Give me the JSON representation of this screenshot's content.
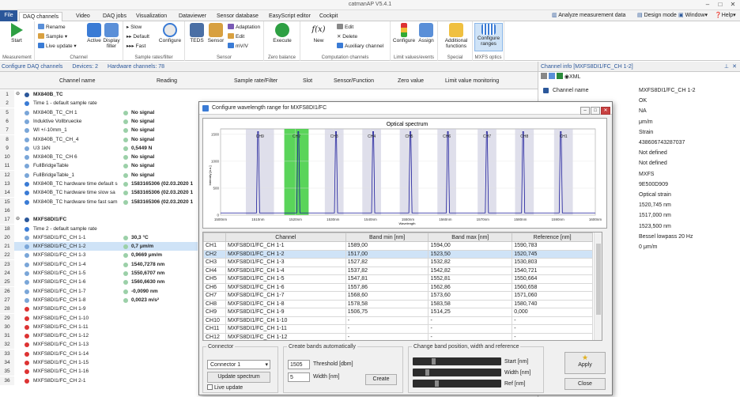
{
  "window": {
    "title": "catmanAP V5.4.1"
  },
  "tabs": [
    {
      "label": "File"
    },
    {
      "label": "DAQ channels"
    },
    {
      "label": "Video"
    },
    {
      "label": "DAQ jobs"
    },
    {
      "label": "Visualization"
    },
    {
      "label": "Dataviewer"
    },
    {
      "label": "Sensor database"
    },
    {
      "label": "EasyScript editor"
    },
    {
      "label": "Cockpit"
    }
  ],
  "right_menu": {
    "analyze": "Analyze measurement data",
    "design": "Design mode",
    "window": "Window",
    "help": "Help"
  },
  "ribbon": {
    "start": "Start",
    "measurement": "Measurement",
    "rename": "Rename",
    "sample": "Sample",
    "live_update": "Live update",
    "channel_group": "Channel",
    "active": "Active",
    "display_filter": "Display filter",
    "slow": "Slow",
    "default": "Default",
    "fast": "Fast",
    "configure": "Configure",
    "sample_group": "Sample rates/filter",
    "teds": "TEDS",
    "sensor": "Sensor",
    "adaptation": "Adaptation",
    "edit": "Edit",
    "mvv": "mV/V",
    "sensor_group": "Sensor",
    "execute": "Execute",
    "zero_group": "Zero balance",
    "new": "New",
    "edit2": "Edit",
    "delete": "Delete",
    "aux": "Auxiliary channel",
    "comp_group": "Computation channels",
    "configure2": "Configure",
    "assign": "Assign",
    "limit_group": "Limit values/events",
    "additional": "Additional functions",
    "special_group": "Special",
    "configure_ranges": "Configure ranges",
    "mxfs_group": "MXFS optics"
  },
  "status": {
    "label": "Configure DAQ channels",
    "devices": "Devices: 2",
    "hardware": "Hardware channels: 78"
  },
  "grid_headers": [
    "Channel name",
    "Reading",
    "Sample rate/Filter",
    "Slot",
    "Sensor/Function",
    "Zero value",
    "Limit value monitoring"
  ],
  "rows": [
    {
      "n": "1",
      "name": "MX840B_TC",
      "reading": "",
      "group": true
    },
    {
      "n": "2",
      "name": "Time  1 - default sample rate",
      "reading": ""
    },
    {
      "n": "5",
      "name": "MX840B_TC_CH 1",
      "reading": "No signal"
    },
    {
      "n": "6",
      "name": "Induktive Vollbruecke",
      "reading": "No signal"
    },
    {
      "n": "7",
      "name": "WI +/-10mm_1",
      "reading": "No signal"
    },
    {
      "n": "8",
      "name": "MX840B_TC_CH_4",
      "reading": "No signal"
    },
    {
      "n": "9",
      "name": "U3 1kN",
      "reading": "0,5449 N"
    },
    {
      "n": "10",
      "name": "MX840B_TC_CH 6",
      "reading": "No signal"
    },
    {
      "n": "11",
      "name": "FullBridgeTable",
      "reading": "No signal"
    },
    {
      "n": "12",
      "name": "FullBridgeTable_1",
      "reading": "No signal"
    },
    {
      "n": "13",
      "name": "MX840B_TC hardware time default s",
      "reading": "1583165306 (02.03.2020 1"
    },
    {
      "n": "14",
      "name": "MX840B_TC hardware time slow sa",
      "reading": "1583165306 (02.03.2020 1"
    },
    {
      "n": "15",
      "name": "MX840B_TC hardware time fast sam",
      "reading": "1583165306 (02.03.2020 1"
    },
    {
      "n": "16",
      "name": "",
      "reading": ""
    },
    {
      "n": "17",
      "name": "MXFS8DI1/FC",
      "reading": "",
      "group": true
    },
    {
      "n": "18",
      "name": "Time  2 - default sample rate",
      "reading": ""
    },
    {
      "n": "20",
      "name": "MXFS8DI1/FC_CH 1-1",
      "reading": "30,3 °C"
    },
    {
      "n": "21",
      "name": "MXFS8DI1/FC_CH 1-2",
      "reading": "0,7 μm/m"
    },
    {
      "n": "22",
      "name": "MXFS8DI1/FC_CH 1-3",
      "reading": "0,9669 μm/m"
    },
    {
      "n": "23",
      "name": "MXFS8DI1/FC_CH 1-4",
      "reading": "1540,7278 nm"
    },
    {
      "n": "24",
      "name": "MXFS8DI1/FC_CH 1-5",
      "reading": "1550,6707 nm"
    },
    {
      "n": "25",
      "name": "MXFS8DI1/FC_CH 1-6",
      "reading": "1560,6630 nm"
    },
    {
      "n": "26",
      "name": "MXFS8DI1/FC_CH 1-7",
      "reading": "-0,0090 nm"
    },
    {
      "n": "27",
      "name": "MXFS8DI1/FC_CH 1-8",
      "reading": "0,0023 m/s²"
    },
    {
      "n": "28",
      "name": "MXFS8DI1/FC_CH 1-9",
      "reading": ""
    },
    {
      "n": "29",
      "name": "MXFS8DI1/FC_CH 1-10",
      "reading": ""
    },
    {
      "n": "30",
      "name": "MXFS8DI1/FC_CH 1-11",
      "reading": ""
    },
    {
      "n": "31",
      "name": "MXFS8DI1/FC_CH 1-12",
      "reading": ""
    },
    {
      "n": "32",
      "name": "MXFS8DI1/FC_CH 1-13",
      "reading": ""
    },
    {
      "n": "33",
      "name": "MXFS8DI1/FC_CH 1-14",
      "reading": ""
    },
    {
      "n": "34",
      "name": "MXFS8DI1/FC_CH 1-15",
      "reading": ""
    },
    {
      "n": "35",
      "name": "MXFS8DI1/FC_CH 1-16",
      "reading": ""
    },
    {
      "n": "36",
      "name": "MXFS8DI1/FC_CH 2-1",
      "reading": ""
    }
  ],
  "info_panel": {
    "title": "Channel info [MXFS8DI1/FC_CH 1-2]",
    "xml": "XML",
    "items": [
      {
        "k": "Channel name",
        "v": "MXFS8DI1/FC_CH 1-2"
      },
      {
        "k": "",
        "v": "OK"
      },
      {
        "k": "",
        "v": "NA"
      },
      {
        "k": "",
        "v": "μm/m"
      },
      {
        "k": "",
        "v": "Strain"
      },
      {
        "k": "",
        "v": "438606743287037"
      },
      {
        "k": "",
        "v": "Not defined"
      },
      {
        "k": "",
        "v": "Not defined"
      },
      {
        "k": "",
        "v": "MXFS"
      },
      {
        "k": "",
        "v": "9E500D909"
      },
      {
        "k": "",
        "v": "Optical strain"
      },
      {
        "k": "",
        "v": "1520,745 nm"
      },
      {
        "k": "",
        "v": "1517,000 nm"
      },
      {
        "k": "",
        "v": "1523,500 nm"
      },
      {
        "k": "",
        "v": "Bessel lowpass 20 Hz"
      },
      {
        "k": "",
        "v": "0 μm/m"
      }
    ]
  },
  "dialog": {
    "title": "Configure wavelength range for MXFS8DI1/FC",
    "chart_title": "Optical spectrum",
    "xlabel": "Wavelength",
    "ylabel": "Intensity [a.u.]",
    "table_headers": [
      "Channel",
      "Band min [nm]",
      "Band max [nm]",
      "Reference [nm]"
    ],
    "table_rows": [
      [
        "CH1",
        "MXFS8DI1/FC_CH 1-1",
        "1589,00",
        "1594,00",
        "1590,783"
      ],
      [
        "CH2",
        "MXFS8DI1/FC_CH 1-2",
        "1517,00",
        "1523,50",
        "1520,745"
      ],
      [
        "CH3",
        "MXFS8DI1/FC_CH 1-3",
        "1527,82",
        "1532,82",
        "1530,803"
      ],
      [
        "CH4",
        "MXFS8DI1/FC_CH 1-4",
        "1537,82",
        "1542,82",
        "1540,721"
      ],
      [
        "CH5",
        "MXFS8DI1/FC_CH 1-5",
        "1547,81",
        "1552,81",
        "1550,664"
      ],
      [
        "CH6",
        "MXFS8DI1/FC_CH 1-6",
        "1557,86",
        "1562,86",
        "1560,658"
      ],
      [
        "CH7",
        "MXFS8DI1/FC_CH 1-7",
        "1568,60",
        "1573,60",
        "1571,060"
      ],
      [
        "CH8",
        "MXFS8DI1/FC_CH 1-8",
        "1578,58",
        "1583,58",
        "1580,740"
      ],
      [
        "CH9",
        "MXFS8DI1/FC_CH 1-9",
        "1506,75",
        "1514,25",
        "0,000"
      ],
      [
        "CH10",
        "MXFS8DI1/FC_CH 1-10",
        "-",
        "-",
        "-"
      ],
      [
        "CH11",
        "MXFS8DI1/FC_CH 1-11",
        "-",
        "-",
        "-"
      ],
      [
        "CH12",
        "MXFS8DI1/FC_CH 1-12",
        "-",
        "-",
        "-"
      ]
    ],
    "connector_legend": "Connector",
    "connector_value": "Connector 1",
    "update_spectrum": "Update spectrum",
    "live_update": "Live update",
    "auto_legend": "Create bands automatically",
    "threshold_value": "1505",
    "threshold_label": "Threshold [dbm]",
    "width_value": "5",
    "width_label": "Width [nm]",
    "create": "Create",
    "change_legend": "Change band position, width and reference",
    "start_label": "Start [nm]",
    "width_label2": "Width [nm]",
    "ref_label": "Ref [nm]",
    "apply": "Apply",
    "close": "Close"
  },
  "chart_data": {
    "type": "line",
    "title": "Optical spectrum",
    "xlabel": "Wavelength",
    "ylabel": "Intensity [a.u.]",
    "xlim": [
      1500,
      1600
    ],
    "ylim": [
      0,
      1600
    ],
    "xticks": [
      "1500nm",
      "1510nm",
      "1520nm",
      "1530nm",
      "1540nm",
      "1550nm",
      "1560nm",
      "1570nm",
      "1580nm",
      "1590nm",
      "1600nm"
    ],
    "yticks": [
      "0",
      "500",
      "1000",
      "1500"
    ],
    "bands": [
      {
        "name": "CH9",
        "min": 1506.75,
        "max": 1514.25,
        "peak": 1510,
        "selected": false
      },
      {
        "name": "CH2",
        "min": 1517.0,
        "max": 1523.5,
        "peak": 1520.745,
        "selected": true
      },
      {
        "name": "CH3",
        "min": 1527.82,
        "max": 1532.82,
        "peak": 1530.803,
        "selected": false
      },
      {
        "name": "CH4",
        "min": 1537.82,
        "max": 1542.82,
        "peak": 1540.721,
        "selected": false
      },
      {
        "name": "CH5",
        "min": 1547.81,
        "max": 1552.81,
        "peak": 1550.664,
        "selected": false
      },
      {
        "name": "CH6",
        "min": 1557.86,
        "max": 1562.86,
        "peak": 1560.658,
        "selected": false
      },
      {
        "name": "CH7",
        "min": 1568.6,
        "max": 1573.6,
        "peak": 1571.06,
        "selected": false
      },
      {
        "name": "CH8",
        "min": 1578.58,
        "max": 1583.58,
        "peak": 1580.74,
        "selected": false
      },
      {
        "name": "CH1",
        "min": 1589.0,
        "max": 1594.0,
        "peak": 1590.783,
        "selected": false
      }
    ],
    "peak_height": 1550
  },
  "colors": {
    "accent": "#2b579a",
    "selected_band": "#3dcc3d",
    "band": "#c9c9dd",
    "peak": "#1a1a9a"
  }
}
